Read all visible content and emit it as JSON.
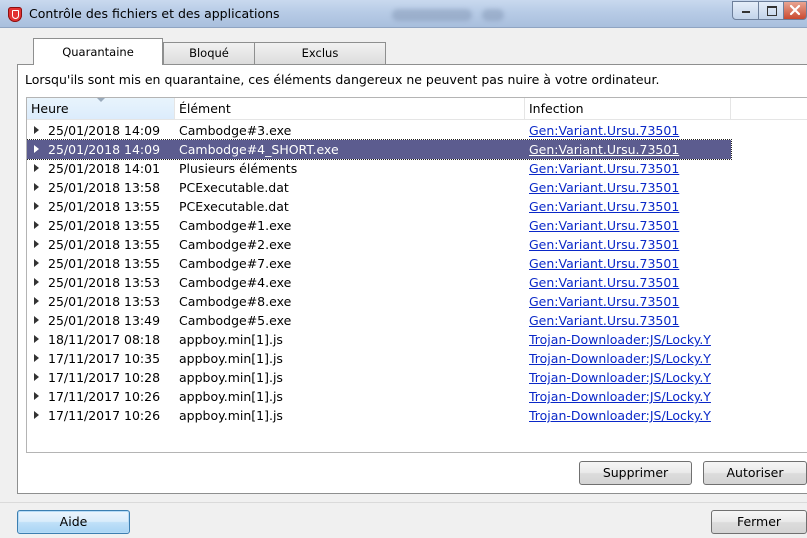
{
  "window": {
    "title": "Contrôle des fichiers et des applications"
  },
  "tabs": [
    {
      "label": "Quarantaine",
      "active": true
    },
    {
      "label": "Bloqué",
      "active": false
    },
    {
      "label": "Exclus",
      "active": false
    }
  ],
  "description": "Lorsqu'ils sont mis en quarantaine, ces éléments dangereux ne peuvent pas nuire à votre ordinateur.",
  "list": {
    "columns": [
      "Heure",
      "Élément",
      "Infection"
    ],
    "rows": [
      {
        "time": "25/01/2018 14:09",
        "element": "Cambodge#3.exe",
        "infection": "Gen:Variant.Ursu.73501",
        "selected": false
      },
      {
        "time": "25/01/2018 14:09",
        "element": "Cambodge#4_SHORT.exe",
        "infection": "Gen:Variant.Ursu.73501",
        "selected": true
      },
      {
        "time": "25/01/2018 14:01",
        "element": "Plusieurs éléments",
        "infection": "Gen:Variant.Ursu.73501",
        "selected": false
      },
      {
        "time": "25/01/2018 13:58",
        "element": "PCExecutable.dat",
        "infection": "Gen:Variant.Ursu.73501",
        "selected": false
      },
      {
        "time": "25/01/2018 13:55",
        "element": "PCExecutable.dat",
        "infection": "Gen:Variant.Ursu.73501",
        "selected": false
      },
      {
        "time": "25/01/2018 13:55",
        "element": "Cambodge#1.exe",
        "infection": "Gen:Variant.Ursu.73501",
        "selected": false
      },
      {
        "time": "25/01/2018 13:55",
        "element": "Cambodge#2.exe",
        "infection": "Gen:Variant.Ursu.73501",
        "selected": false
      },
      {
        "time": "25/01/2018 13:55",
        "element": "Cambodge#7.exe",
        "infection": "Gen:Variant.Ursu.73501",
        "selected": false
      },
      {
        "time": "25/01/2018 13:53",
        "element": "Cambodge#4.exe",
        "infection": "Gen:Variant.Ursu.73501",
        "selected": false
      },
      {
        "time": "25/01/2018 13:53",
        "element": "Cambodge#8.exe",
        "infection": "Gen:Variant.Ursu.73501",
        "selected": false
      },
      {
        "time": "25/01/2018 13:49",
        "element": "Cambodge#5.exe",
        "infection": "Gen:Variant.Ursu.73501",
        "selected": false
      },
      {
        "time": "18/11/2017 08:18",
        "element": "appboy.min[1].js",
        "infection": "Trojan-Downloader:JS/Locky.Y",
        "selected": false
      },
      {
        "time": "17/11/2017 10:35",
        "element": "appboy.min[1].js",
        "infection": "Trojan-Downloader:JS/Locky.Y",
        "selected": false
      },
      {
        "time": "17/11/2017 10:28",
        "element": "appboy.min[1].js",
        "infection": "Trojan-Downloader:JS/Locky.Y",
        "selected": false
      },
      {
        "time": "17/11/2017 10:26",
        "element": "appboy.min[1].js",
        "infection": "Trojan-Downloader:JS/Locky.Y",
        "selected": false
      },
      {
        "time": "17/11/2017 10:26",
        "element": "appboy.min[1].js",
        "infection": "Trojan-Downloader:JS/Locky.Y",
        "selected": false
      }
    ]
  },
  "buttons": {
    "delete": "Supprimer",
    "allow": "Autoriser",
    "help": "Aide",
    "close": "Fermer"
  },
  "icons": {
    "app": "shield-icon",
    "minimize": "minimize-icon",
    "maximize": "maximize-icon",
    "close": "close-icon",
    "expand": "chevron-right-icon",
    "sort": "sort-arrow-icon"
  },
  "colors": {
    "selection": "#5c5c8f",
    "link": "#0a28c8",
    "titlebar": "#b7cbe6",
    "close_button": "#c94a2f"
  }
}
